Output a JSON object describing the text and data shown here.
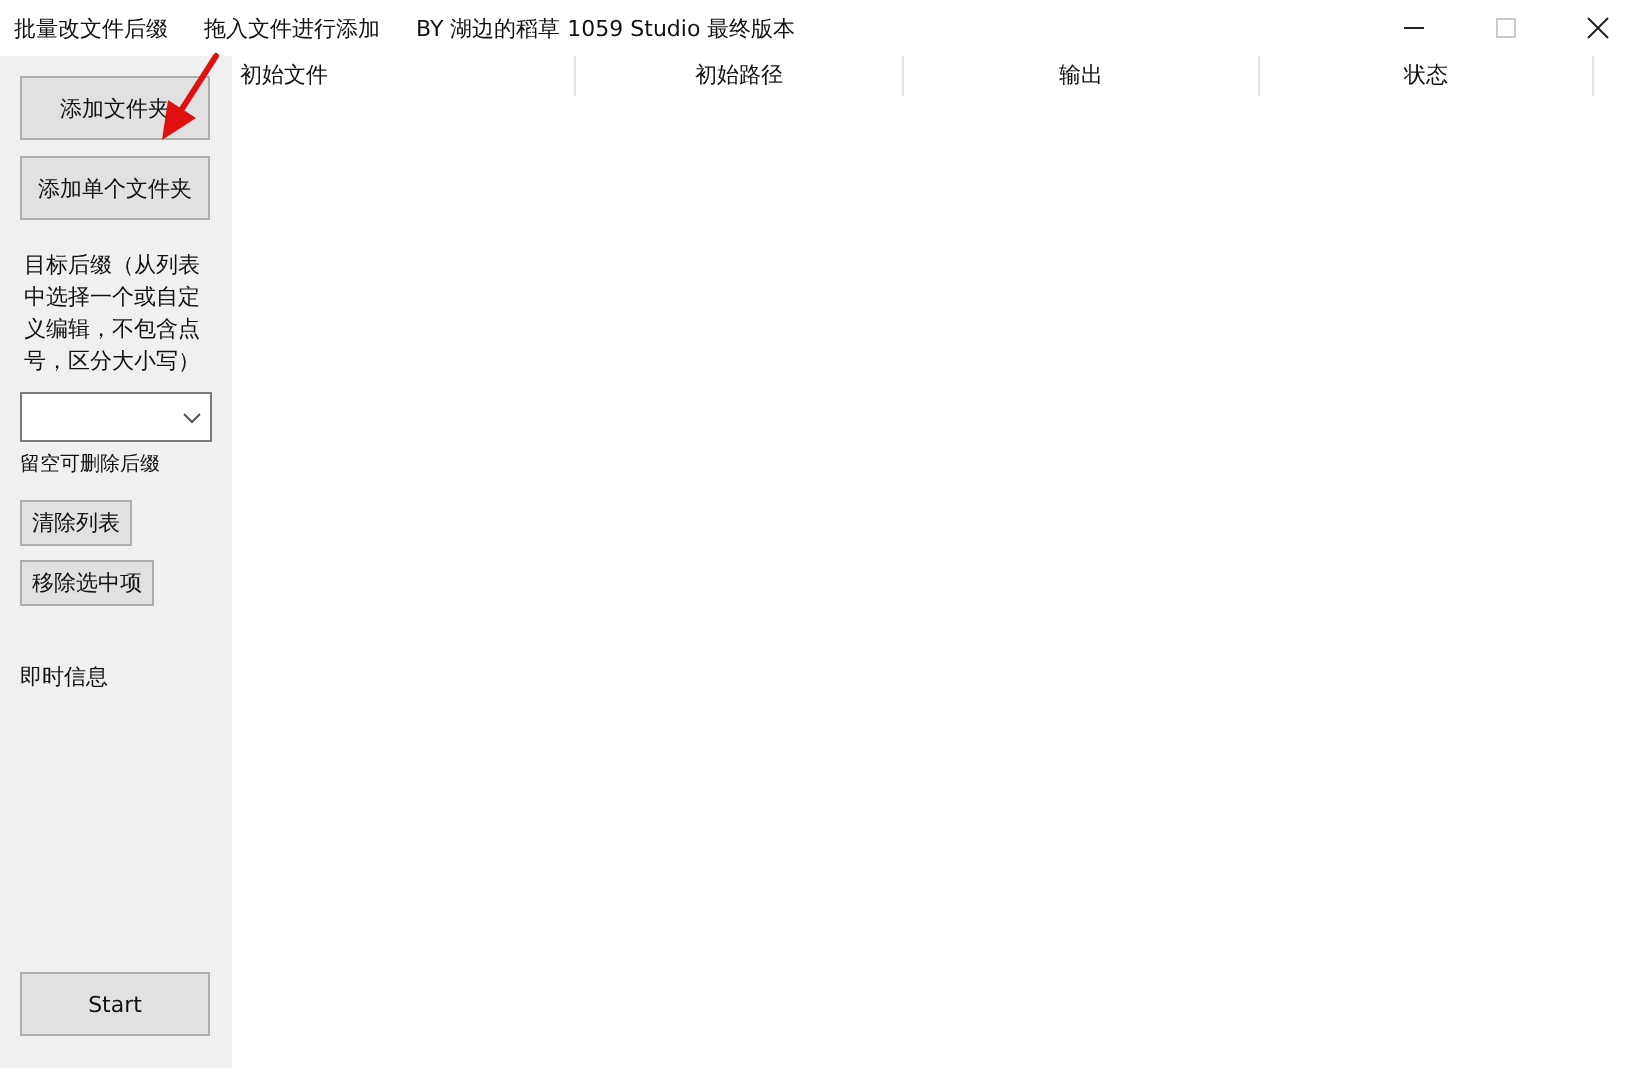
{
  "title_bar": {
    "texts": [
      "批量改文件后缀",
      "拖入文件进行添加",
      "BY 湖边的稻草 1059 Studio 最终版本"
    ],
    "maximize_disabled": true
  },
  "sidebar": {
    "add_folder_button": "添加文件夹",
    "add_single_folder_button": "添加单个文件夹",
    "suffix_label": "目标后缀（从列表中选择一个或自定义编辑，不包含点号，区分大小写）",
    "suffix_hint": "留空可删除后缀",
    "clear_button": "清除列表",
    "remove_button": "移除选中项",
    "info_label": "即时信息",
    "start_button": "Start"
  },
  "table": {
    "columns": [
      "初始文件",
      "初始路径",
      "输出",
      "状态"
    ]
  }
}
